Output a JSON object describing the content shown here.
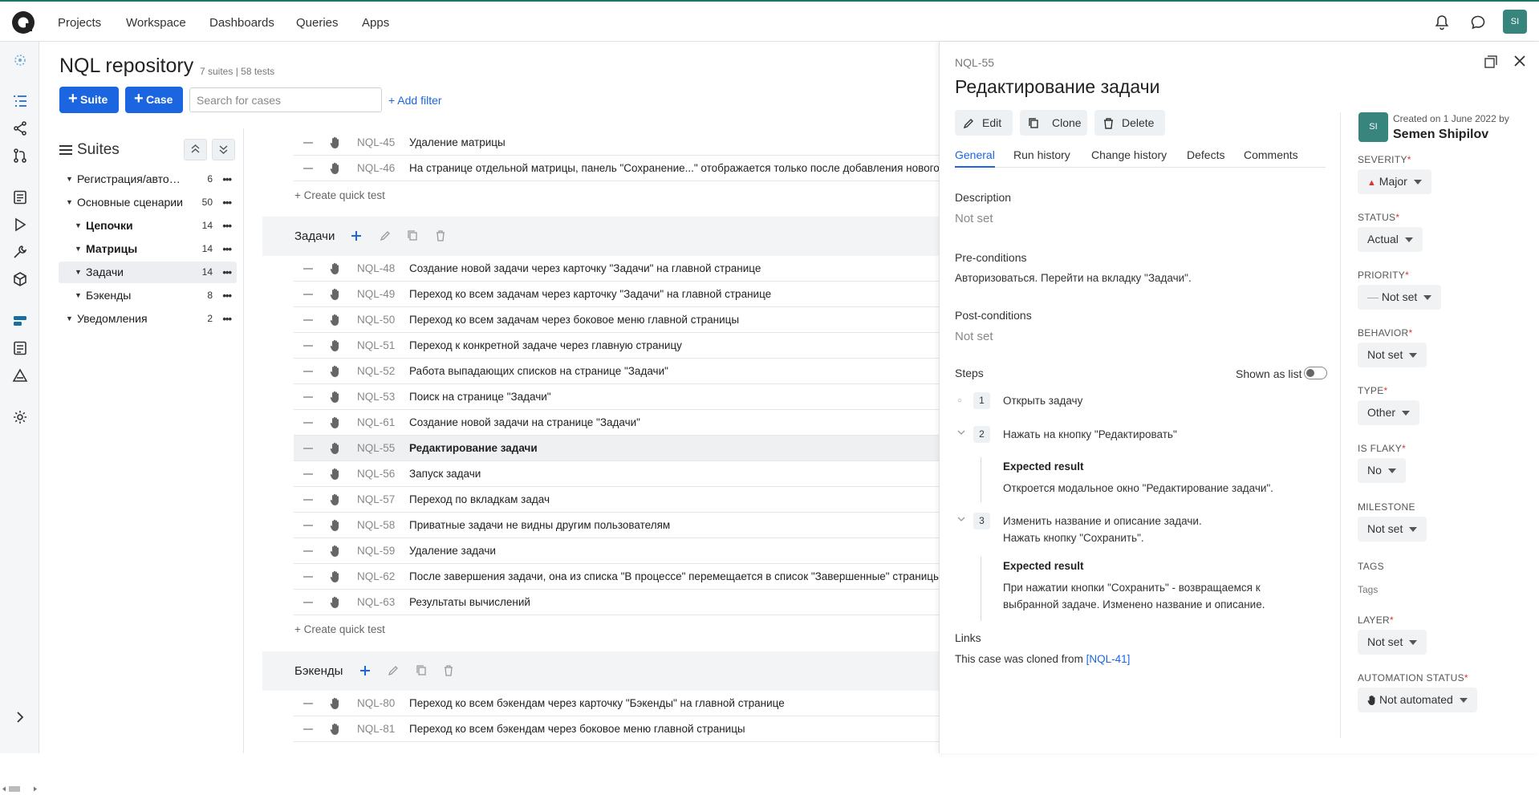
{
  "topnav": {
    "items": [
      "Projects",
      "Workspace",
      "Dashboards",
      "Queries",
      "Apps"
    ],
    "user_initials": "SI"
  },
  "page": {
    "title": "NQL repository",
    "meta": "7 suites | 58 tests"
  },
  "toolbar": {
    "suite_label": "Suite",
    "case_label": "Case",
    "search_placeholder": "Search for cases",
    "add_filter": "+ Add filter"
  },
  "suites": {
    "title": "Suites",
    "tree": [
      {
        "label": "Регистрация/авторизация",
        "count": "6"
      },
      {
        "label": "Основные сценарии",
        "count": "50"
      },
      {
        "label": "Цепочки",
        "count": "14"
      },
      {
        "label": "Матрицы",
        "count": "14"
      },
      {
        "label": "Задачи",
        "count": "14"
      },
      {
        "label": "Бэкенды",
        "count": "8"
      },
      {
        "label": "Уведомления",
        "count": "2"
      }
    ]
  },
  "cases": {
    "top_rows": [
      {
        "id": "NQL-45",
        "title": "Удаление матрицы"
      },
      {
        "id": "NQL-46",
        "title": "На странице отдельной матрицы, панель \"Сохранение...\" отображается только после добавления нового элемента"
      }
    ],
    "quick_test": "+ Create quick test",
    "groups": [
      {
        "name": "Задачи",
        "rows": [
          {
            "id": "NQL-48",
            "title": "Создание новой задачи через карточку \"Задачи\" на главной странице"
          },
          {
            "id": "NQL-49",
            "title": "Переход ко всем задачам через карточку \"Задачи\" на главной странице"
          },
          {
            "id": "NQL-50",
            "title": "Переход ко всем задачам через боковое меню главной страницы"
          },
          {
            "id": "NQL-51",
            "title": "Переход к конкретной задаче через главную страницу"
          },
          {
            "id": "NQL-52",
            "title": "Работа выпадающих списков на странице \"Задачи\""
          },
          {
            "id": "NQL-53",
            "title": "Поиск на странице \"Задачи\""
          },
          {
            "id": "NQL-61",
            "title": "Создание новой задачи на странице \"Задачи\""
          },
          {
            "id": "NQL-55",
            "title": "Редактирование задачи"
          },
          {
            "id": "NQL-56",
            "title": "Запуск задачи"
          },
          {
            "id": "NQL-57",
            "title": "Переход по вкладкам задач"
          },
          {
            "id": "NQL-58",
            "title": "Приватные задачи не видны другим пользователям"
          },
          {
            "id": "NQL-59",
            "title": "Удаление задачи"
          },
          {
            "id": "NQL-62",
            "title": "После завершения задачи, она из списка \"В процессе\" перемещается в список \"Завершенные\" страницы"
          },
          {
            "id": "NQL-63",
            "title": "Результаты вычислений"
          }
        ]
      },
      {
        "name": "Бэкенды",
        "rows": [
          {
            "id": "NQL-80",
            "title": "Переход ко всем бэкендам через карточку \"Бэкенды\" на главной странице"
          },
          {
            "id": "NQL-81",
            "title": "Переход ко всем бэкендам через боковое меню главной страницы"
          }
        ]
      }
    ]
  },
  "panel": {
    "case_id": "NQL-55",
    "title": "Редактирование задачи",
    "actions": {
      "edit": "Edit",
      "clone": "Clone",
      "delete": "Delete"
    },
    "tabs": [
      "General",
      "Run history",
      "Change history",
      "Defects",
      "Comments"
    ],
    "description": {
      "label": "Description",
      "value": "Not set"
    },
    "preconditions": {
      "label": "Pre-conditions",
      "value": "Авторизоваться. Перейти на вкладку \"Задачи\"."
    },
    "postconditions": {
      "label": "Post-conditions",
      "value": "Not set"
    },
    "steps": {
      "label": "Steps",
      "shown_as_list": "Shown as list",
      "expected_label": "Expected result",
      "items": [
        {
          "num": "1",
          "action": "Открыть задачу"
        },
        {
          "num": "2",
          "action": "Нажать на кнопку \"Редактировать\"",
          "expected": "Откроется модальное окно \"Редактирование задачи\"."
        },
        {
          "num": "3",
          "action_line1": "Изменить название и описание задачи.",
          "action_line2": "Нажать кнопку \"Сохранить\".",
          "expected_line1": "При нажатии кнопки \"Сохранить\" - возвращаемся к",
          "expected_line2": "выбранной задаче. Изменено название и описание."
        }
      ]
    },
    "links": {
      "label": "Links",
      "text": "This case was cloned from",
      "link": "[NQL-41]"
    },
    "sidebar": {
      "created": "Created on 1 June 2022 by",
      "creator": "Semen Shipilov",
      "initials": "SI",
      "fields": [
        {
          "label": "SEVERITY",
          "value": "Major"
        },
        {
          "label": "STATUS",
          "value": "Actual"
        },
        {
          "label": "PRIORITY",
          "value": "Not set"
        },
        {
          "label": "BEHAVIOR",
          "value": "Not set"
        },
        {
          "label": "TYPE",
          "value": "Other"
        },
        {
          "label": "IS FLAKY",
          "value": "No"
        },
        {
          "label": "MILESTONE",
          "value": "Not set"
        },
        {
          "label": "TAGS",
          "value": "Tags"
        },
        {
          "label": "LAYER",
          "value": "Not set"
        },
        {
          "label": "AUTOMATION STATUS",
          "value": "Not automated"
        }
      ]
    }
  },
  "colors": {
    "primary": "#1b66e0",
    "accent": "#38857e",
    "required": "#d33"
  }
}
